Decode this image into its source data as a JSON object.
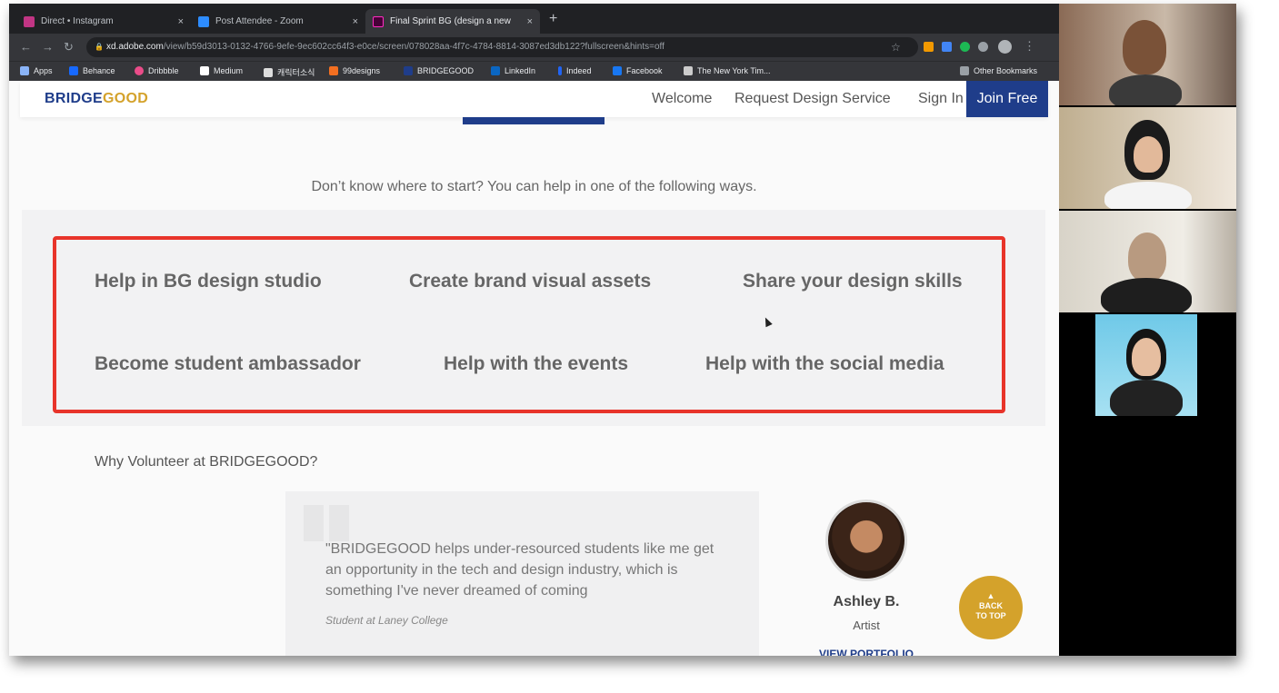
{
  "browser": {
    "tabs": [
      {
        "label": "Direct • Instagram",
        "close": "×",
        "color": "#c13584"
      },
      {
        "label": "Post Attendee - Zoom",
        "close": "×",
        "color": "#2d8cff"
      },
      {
        "label": "Final Sprint BG (design a new ",
        "close": "×",
        "color": "#ff2bc2"
      }
    ],
    "new_tab": "+",
    "url_domain": "xd.adobe.com",
    "url_path": "/view/b59d3013-0132-4766-9efe-9ec602cc64f3-e0ce/screen/078028aa-4f7c-4784-8814-3087ed3db122?fullscreen&hints=off",
    "bookmarks": [
      {
        "label": "Apps",
        "color": "#8ab4f8"
      },
      {
        "label": "Behance",
        "color": "#1769ff"
      },
      {
        "label": "Dribbble",
        "color": "#ea4c89"
      },
      {
        "label": "Medium",
        "color": "#ffffff"
      },
      {
        "label": "캐릭터소식",
        "color": "#dddddd"
      },
      {
        "label": "99designs",
        "color": "#f36f21"
      },
      {
        "label": "BRIDGEGOOD",
        "color": "#1f3d8a"
      },
      {
        "label": "LinkedIn",
        "color": "#0a66c2"
      },
      {
        "label": "Indeed",
        "color": "#2164f3"
      },
      {
        "label": "Facebook",
        "color": "#1877f2"
      },
      {
        "label": "The New York Tim...",
        "color": "#cccccc"
      }
    ],
    "other_bookmarks": "Other Bookmarks"
  },
  "site": {
    "logo_bridge": "BRIDGE",
    "logo_good": "GOOD",
    "nav": {
      "welcome": "Welcome",
      "request": "Request Design Service",
      "signin": "Sign In",
      "join": "Join Free"
    },
    "intro": "Don’t know where to start? You can help in one of the following ways.",
    "help_options": [
      "Help in BG design studio",
      "Create brand visual assets",
      "Share your design skills",
      "Become student ambassador",
      "Help with the events",
      "Help with the social media"
    ],
    "why_heading": "Why Volunteer at BRIDGEGOOD?",
    "testimonial": {
      "quote": "\"BRIDGEGOOD helps under-resourced students like me get an opportunity in the tech and design industry, which is something I've never dreamed of coming",
      "source": "Student at Laney College",
      "name": "Ashley B.",
      "role": "Artist",
      "portfolio": "VIEW PORTFOLIO"
    },
    "back_to_top_arrow": "▲",
    "back_to_top_1": "BACK",
    "back_to_top_2": "TO TOP"
  },
  "colors": {
    "brand_blue": "#1f3d8a",
    "brand_gold": "#d4a22b",
    "highlight_red": "#e8342a"
  }
}
